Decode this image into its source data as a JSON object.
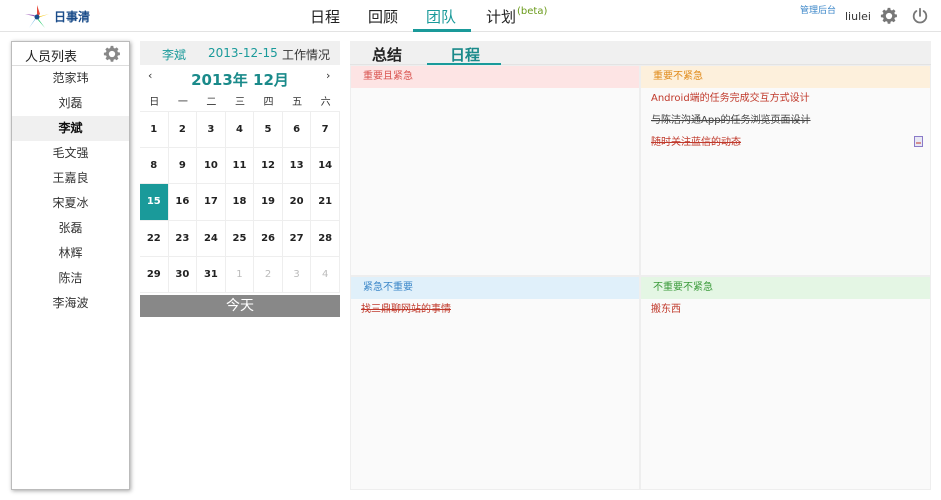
{
  "app": {
    "logo_text": "日事清"
  },
  "nav": {
    "items": [
      "日程",
      "回顾",
      "团队",
      "计划"
    ],
    "active": "团队",
    "beta": "(beta)",
    "admin_link": "管理后台",
    "username": "liulei"
  },
  "people": {
    "title": "人员列表",
    "items": [
      "范家玮",
      "刘磊",
      "李斌",
      "毛文强",
      "王嘉良",
      "宋夏冰",
      "张磊",
      "林辉",
      "陈洁",
      "李海波"
    ],
    "selected": "李斌"
  },
  "calendar": {
    "header_name": "李斌",
    "header_date": "2013-12-15",
    "header_label": "工作情况",
    "prev": "‹",
    "next": "›",
    "month_label": "2013年 12月",
    "weekdays": [
      "日",
      "一",
      "二",
      "三",
      "四",
      "五",
      "六"
    ],
    "days": [
      "1",
      "2",
      "3",
      "4",
      "5",
      "6",
      "7",
      "8",
      "9",
      "10",
      "11",
      "12",
      "13",
      "14",
      "15",
      "16",
      "17",
      "18",
      "19",
      "20",
      "21",
      "22",
      "23",
      "24",
      "25",
      "26",
      "27",
      "28",
      "29",
      "30",
      "31",
      "1",
      "2",
      "3",
      "4"
    ],
    "today_day": "15",
    "today_button": "今天"
  },
  "main": {
    "tabs": [
      "总结",
      "日程"
    ],
    "active_tab": "日程",
    "quadrants": {
      "q1": {
        "title": "重要且紧急",
        "color": "#d9534f",
        "bg": "#fde4e4",
        "items": []
      },
      "q2": {
        "title": "重要不紧急",
        "color": "#e08a1a",
        "bg": "#fdf0dc",
        "items": [
          {
            "text": "Android端的任务完成交互方式设计",
            "done": false
          },
          {
            "text": "与陈洁沟通App的任务浏览页面设计",
            "done": true
          },
          {
            "text": "随时关注蓝信的动态",
            "done": true
          }
        ]
      },
      "q3": {
        "title": "紧急不重要",
        "color": "#3a86c8",
        "bg": "#e0f0fa",
        "items": [
          {
            "text": "找三鼎聊网站的事情",
            "done": true
          }
        ]
      },
      "q4": {
        "title": "不重要不紧急",
        "color": "#3a9a3a",
        "bg": "#e4f6e4",
        "items": [
          {
            "text": "搬东西",
            "done": false
          }
        ]
      }
    }
  }
}
